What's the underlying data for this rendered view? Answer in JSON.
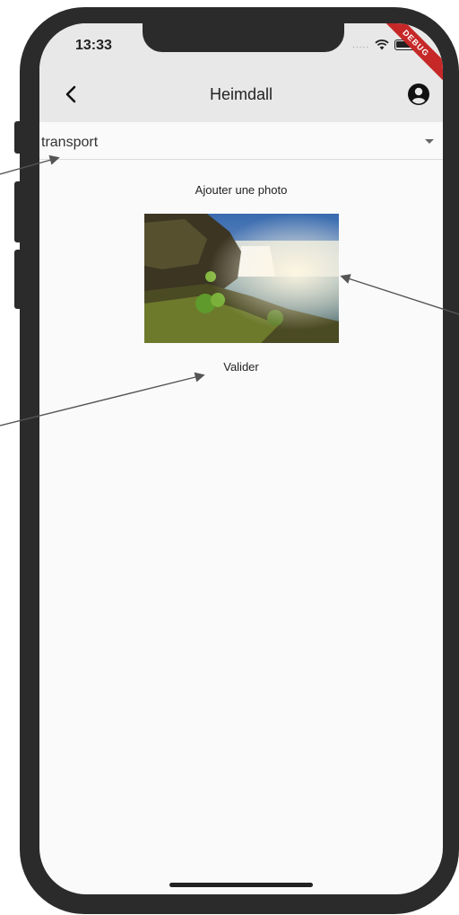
{
  "status_bar": {
    "time": "13:33",
    "signal_dots": ".....",
    "debug_label": "DEBUG"
  },
  "app_bar": {
    "title": "Heimdall",
    "back_icon": "chevron-left-icon",
    "account_icon": "account-circle-icon"
  },
  "form": {
    "category_value": "transport",
    "add_photo_label": "Ajouter une photo",
    "validate_label": "Valider"
  },
  "colors": {
    "app_bar_bg": "#e8e8e8",
    "screen_bg": "#fafafa",
    "debug_ribbon": "#c62828",
    "frame": "#2b2b2b"
  }
}
